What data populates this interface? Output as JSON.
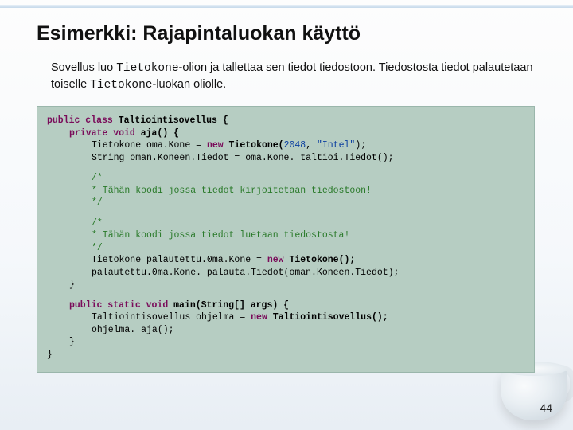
{
  "title": "Esimerkki: Rajapintaluokan käyttö",
  "desc": {
    "pre1": "Sovellus luo ",
    "mono1": "Tietokone",
    "mid1": "-olion ja tallettaa sen tiedot tiedostoon. Tiedostosta tiedot palautetaan toiselle ",
    "mono2": "Tietokone",
    "post1": "-luokan oliolle."
  },
  "code": {
    "l1a": "public class",
    "l1b": " Taltiointisovellus {",
    "l2a": "private void",
    "l2b": " aja() {",
    "l3a": "Tietokone oma.Kone = ",
    "l3b": "new",
    "l3c": " Tietokone(",
    "l3num": "2048",
    "l3d": ", ",
    "l3str": "\"Intel\"",
    "l3e": ");",
    "l4": "String oman.Koneen.Tiedot = oma.Kone. taltioi.Tiedot();",
    "c1a": "/*",
    "c1b": " * Tähän koodi jossa tiedot kirjoitetaan tiedostoon!",
    "c1c": " */",
    "c2a": "/*",
    "c2b": " * Tähän koodi jossa tiedot luetaan tiedostosta!",
    "c2c": " */",
    "l5a": "Tietokone palautettu.0ma.Kone = ",
    "l5b": "new",
    "l5c": " Tietokone();",
    "l6": "palautettu.0ma.Kone. palauta.Tiedot(oman.Koneen.Tiedot);",
    "l7": "}",
    "m1a": "public static void",
    "m1b": " main(String[] args) {",
    "m2a": "Taltiointisovellus ohjelma = ",
    "m2b": "new",
    "m2c": " Taltiointisovellus();",
    "m3": "ohjelma. aja();",
    "m4": "}",
    "end": "}"
  },
  "page": "44"
}
